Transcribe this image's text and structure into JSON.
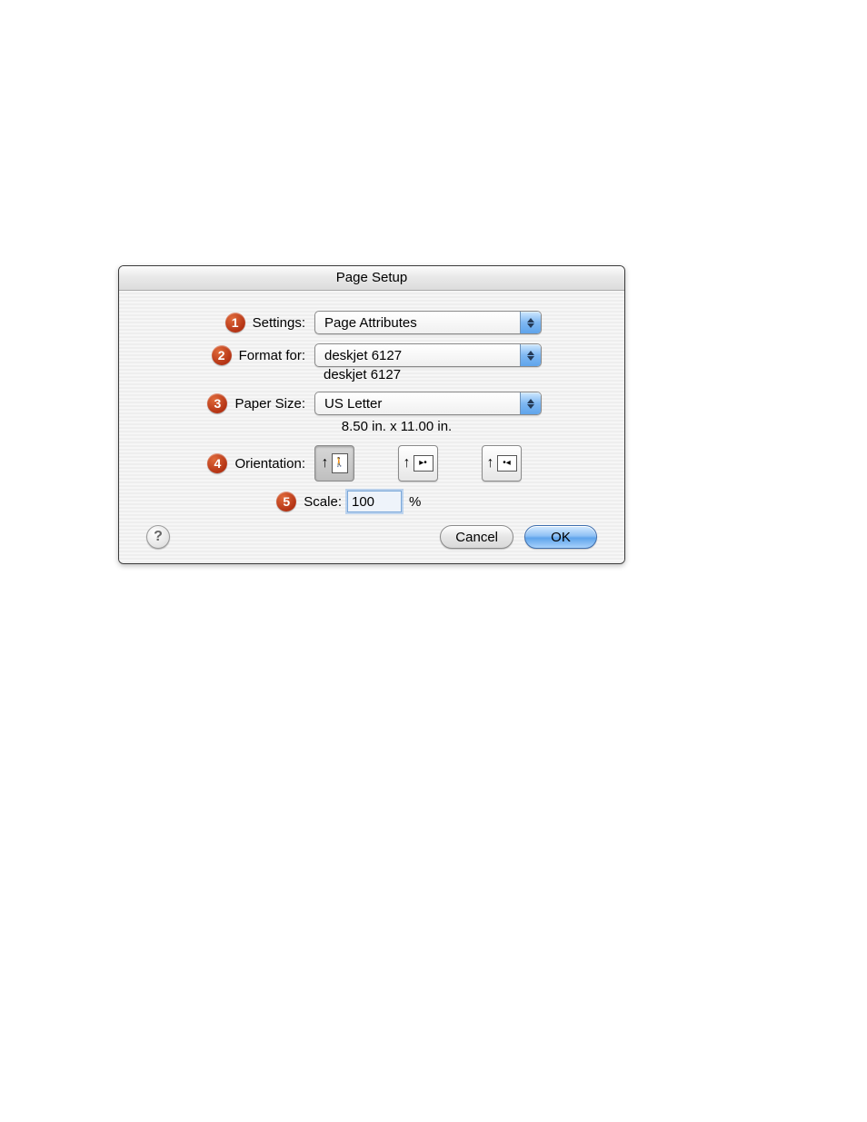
{
  "dialog": {
    "title": "Page Setup",
    "settings": {
      "badge": "1",
      "label": "Settings:",
      "value": "Page Attributes"
    },
    "format_for": {
      "badge": "2",
      "label": "Format for:",
      "value": "deskjet 6127",
      "subtext": "deskjet 6127"
    },
    "paper_size": {
      "badge": "3",
      "label": "Paper Size:",
      "value": "US Letter",
      "dimensions": "8.50 in. x 11.00 in."
    },
    "orientation": {
      "badge": "4",
      "label": "Orientation:",
      "selected": "portrait"
    },
    "scale": {
      "badge": "5",
      "label": "Scale:",
      "value": "100",
      "suffix": "%"
    },
    "buttons": {
      "help": "?",
      "cancel": "Cancel",
      "ok": "OK"
    }
  }
}
